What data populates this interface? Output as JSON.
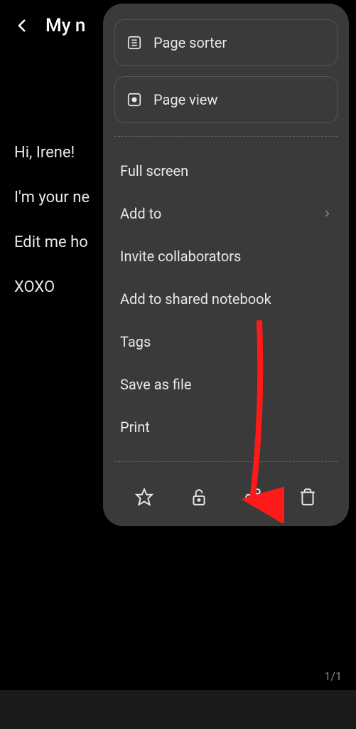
{
  "header": {
    "title_truncated": "My n"
  },
  "note": {
    "line1": "Hi, Irene!",
    "line2": "I'm your ne",
    "line3": "Edit me ho",
    "line4": "XOXO"
  },
  "menu": {
    "page_sorter": "Page sorter",
    "page_view": "Page view",
    "full_screen": "Full screen",
    "add_to": "Add to",
    "invite": "Invite collaborators",
    "shared_notebook": "Add to shared notebook",
    "tags": "Tags",
    "save_as_file": "Save as file",
    "print": "Print"
  },
  "footer_icons": {
    "star": "star-icon",
    "lock": "unlock-icon",
    "share": "share-icon",
    "trash": "trash-icon"
  },
  "page_indicator": "1/1"
}
